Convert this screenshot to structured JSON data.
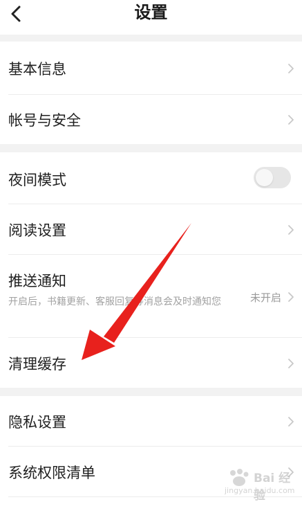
{
  "header": {
    "title": "设置"
  },
  "sections": [
    {
      "items": [
        {
          "label": "基本信息"
        },
        {
          "label": "帐号与安全"
        }
      ]
    },
    {
      "items": [
        {
          "label": "夜间模式",
          "toggle_on": false
        },
        {
          "label": "阅读设置"
        },
        {
          "label": "推送通知",
          "description": "开启后，书籍更新、客服回复等消息会及时通知您",
          "status": "未开启"
        },
        {
          "label": "清理缓存"
        }
      ]
    },
    {
      "items": [
        {
          "label": "隐私设置"
        },
        {
          "label": "系统权限清单"
        }
      ]
    }
  ],
  "watermark": {
    "text": "Bai 经验",
    "url": "jingyan.baidu.com"
  },
  "colors": {
    "arrow": "#e8211d",
    "toggle_off": "#e6e6e6",
    "background": "#f2f2f2"
  }
}
